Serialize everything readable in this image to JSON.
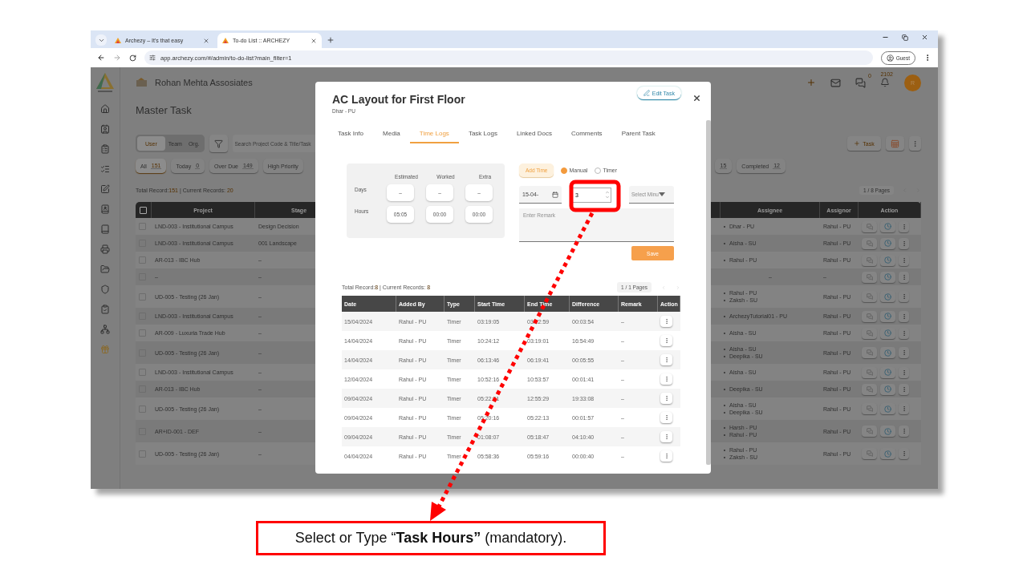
{
  "browser": {
    "tabs": [
      {
        "title": "Archezy – It's that easy",
        "selected": false
      },
      {
        "title": "To-do List :: ARCHEZY",
        "selected": true
      }
    ],
    "url": "app.archezy.com/#/admin/to-do-list?main_filter=1",
    "profile": "Guest"
  },
  "app": {
    "company": "Rohan Mehta Assosiates",
    "header": {
      "messages_count": "0",
      "notifications_count": "2102",
      "avatar": "R"
    },
    "page_title": "Master Task",
    "scope_tabs": [
      {
        "label": "User",
        "selected": true
      },
      {
        "label": "Team",
        "selected": false
      },
      {
        "label": "Org.",
        "selected": false
      }
    ],
    "search": {
      "placeholder": "Search Project Code & Title/Task"
    },
    "new_task_button": "Task",
    "filters": [
      {
        "label": "All",
        "count": "151",
        "selected": true
      },
      {
        "label": "Today",
        "count": "0",
        "selected": false
      },
      {
        "label": "Over Due",
        "count": "149",
        "selected": false
      },
      {
        "label": "High Priority",
        "selected": false
      },
      {
        "count": "15",
        "selected": false
      },
      {
        "label": "Completed",
        "count": "12",
        "selected": false
      }
    ],
    "summary": {
      "total_label": "Total Record:",
      "total": "151",
      "current_label": "| Current Records:",
      "current": "20"
    },
    "pages": "1 / 8 Pages",
    "table": {
      "select_all_checked": false,
      "columns": [
        "Project",
        "Stage",
        "Assignee",
        "Assignor",
        "Action"
      ],
      "rows": [
        {
          "checked": false,
          "project": "LND-003 - Institutional Campus",
          "stage": "Design Decision",
          "assignees": [
            "Dhar - PU"
          ],
          "assignor": "Rahul - PU"
        },
        {
          "checked": false,
          "project": "LND-003 - Institutional Campus",
          "stage": "001 Landscape",
          "assignees": [
            "Aisha - SU"
          ],
          "assignor": "Rahul - PU"
        },
        {
          "checked": false,
          "project": "AR-013 - IBC Hub",
          "stage": "–",
          "assignees": [
            "Rahul - PU"
          ],
          "assignor": "Rahul - PU"
        },
        {
          "checked": false,
          "project": "–",
          "stage": "–",
          "assignee": "–",
          "assignor": "–"
        },
        {
          "checked": false,
          "project": "UD-005 - Testing (26 Jan)",
          "stage": "–",
          "assignees": [
            "Rahul - PU",
            "Zaksh - SU"
          ],
          "assignor": "Rahul - PU"
        },
        {
          "checked": false,
          "project": "LND-003 - Institutional Campus",
          "stage": "–",
          "assignees": [
            "ArchezyTutorial01 - PU"
          ],
          "assignor": "Rahul - PU"
        },
        {
          "checked": false,
          "project": "AR-009 - Luxuria Trade Hub",
          "stage": "–",
          "assignees": [
            "Aisha - SU"
          ],
          "assignor": "Rahul - PU"
        },
        {
          "checked": false,
          "project": "UD-005 - Testing (26 Jan)",
          "stage": "–",
          "assignees": [
            "Aisha - SU",
            "Deepika - SU"
          ],
          "assignor": "Rahul - PU"
        },
        {
          "checked": false,
          "project": "LND-003 - Institutional Campus",
          "stage": "–",
          "assignees": [
            "Aisha - SU"
          ],
          "assignor": "Rahul - PU"
        },
        {
          "checked": false,
          "project": "AR-013 - IBC Hub",
          "stage": "–",
          "assignees": [
            "Deepika - SU"
          ],
          "assignor": "Rahul - PU"
        },
        {
          "checked": false,
          "project": "UD-005 - Testing (26 Jan)",
          "stage": "–",
          "assignees": [
            "Aisha - SU",
            "Deepika - SU"
          ],
          "assignor": "Rahul - PU"
        },
        {
          "checked": false,
          "project": "AR+ID-001 - DEF",
          "stage": "–",
          "assignees": [
            "Harsh - PU",
            "Rahul - PU"
          ],
          "assignor": "Rahul - PU"
        },
        {
          "checked": false,
          "project": "UD-005 - Testing (26 Jan)",
          "stage": "–",
          "assignees": [
            "Rahul - PU",
            "Zaksh - SU"
          ],
          "assignor": "Rahul - PU"
        }
      ]
    }
  },
  "modal": {
    "title": "AC Layout for First Floor",
    "subtitle": "Dhar - PU",
    "edit_button": "Edit Task",
    "tabs": [
      {
        "label": "Task Info",
        "selected": false
      },
      {
        "label": "Media",
        "selected": false
      },
      {
        "label": "Time Logs",
        "selected": true
      },
      {
        "label": "Task Logs",
        "selected": false
      },
      {
        "label": "Linked Docs",
        "selected": false
      },
      {
        "label": "Comments",
        "selected": false
      },
      {
        "label": "Parent Task",
        "selected": false
      }
    ],
    "time_summary": {
      "columns": [
        "Estimated",
        "Worked",
        "Extra"
      ],
      "rows": [
        {
          "label": "Days",
          "values": [
            "–",
            "–",
            "–"
          ]
        },
        {
          "label": "Hours",
          "values": [
            "05:05",
            "00:00",
            "00:00"
          ]
        }
      ]
    },
    "entry": {
      "add_time_button": "Add Time",
      "modes": [
        {
          "label": "Manual",
          "selected": true
        },
        {
          "label": "Timer",
          "selected": false
        }
      ],
      "date": "15-04-",
      "hours": "3",
      "minutes_placeholder": "Select Minu",
      "remark_placeholder": "Enter Remark",
      "save_button": "Save"
    },
    "log_summary": {
      "total_label": "Total Record:",
      "total": "8",
      "current_label": "| Current Records:",
      "current": "8"
    },
    "log_pages": "1 / 1 Pages",
    "log_table": {
      "columns": [
        "Date",
        "Added By",
        "Type",
        "Start Time",
        "End Time",
        "Difference",
        "Remark",
        "Action"
      ],
      "rows": [
        [
          "15/04/2024",
          "Rahul - PU",
          "Timer",
          "03:19:05",
          "03:22:59",
          "00:03:54",
          "–"
        ],
        [
          "14/04/2024",
          "Rahul - PU",
          "Timer",
          "10:24:12",
          "03:19:01",
          "16:54:49",
          "–"
        ],
        [
          "14/04/2024",
          "Rahul - PU",
          "Timer",
          "06:13:46",
          "06:19:41",
          "00:05:55",
          "–"
        ],
        [
          "12/04/2024",
          "Rahul - PU",
          "Timer",
          "10:52:16",
          "10:53:57",
          "00:01:41",
          "–"
        ],
        [
          "09/04/2024",
          "Rahul - PU",
          "Timer",
          "05:22:21",
          "12:55:29",
          "19:33:08",
          "–"
        ],
        [
          "09/04/2024",
          "Rahul - PU",
          "Timer",
          "05:20:16",
          "05:22:13",
          "00:01:57",
          "–"
        ],
        [
          "09/04/2024",
          "Rahul - PU",
          "Timer",
          "01:08:07",
          "05:18:47",
          "04:10:40",
          "–"
        ],
        [
          "04/04/2024",
          "Rahul - PU",
          "Timer",
          "05:58:36",
          "05:59:16",
          "00:00:40",
          "–"
        ]
      ]
    }
  },
  "callout": {
    "text": "Select or Type “**Task Hours”** (mandatory)."
  }
}
